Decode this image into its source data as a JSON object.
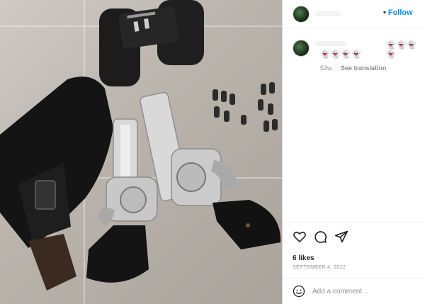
{
  "post": {
    "header": {
      "follow_separator": "•",
      "follow_label": "Follow"
    },
    "caption": {
      "emoji_row_1": "👻👻👻👻",
      "emoji_row_2": "👻👻👻👻",
      "timestamp": "52w",
      "see_translation": "See translation"
    },
    "actions": {
      "like_icon": "heart-icon",
      "comment_icon": "speech-bubble-icon",
      "share_icon": "paper-plane-icon"
    },
    "likes": "6 likes",
    "date": "SEPTEMBER 4, 2022",
    "comment_box": {
      "emoji_icon": "smile-icon",
      "placeholder": "Add a comment..."
    }
  },
  "photo": {
    "subject": "binoculars, holster and two revolvers on tiled floor"
  }
}
